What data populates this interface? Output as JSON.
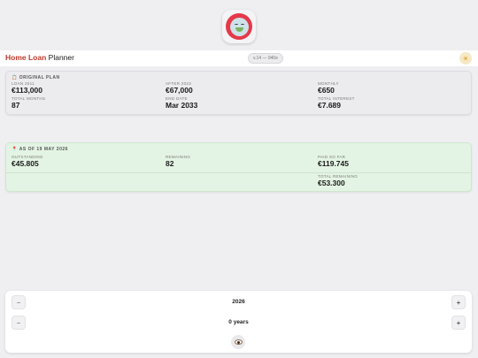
{
  "app": {
    "title_accent": "Home Loan",
    "title_rest": "Planner",
    "version": "v.14 — 940e",
    "icons": {
      "app": "sick-face-app-icon",
      "theme": "sun-icon"
    }
  },
  "plan": {
    "title": "ORIGINAL PLAN",
    "icon": "clipboard-icon",
    "fields": [
      {
        "label": "LOAN 2011",
        "value": "€113,000"
      },
      {
        "label": "AFTER 2023",
        "value": "€67,000"
      },
      {
        "label": "MONTHLY",
        "value": "€650"
      },
      {
        "label": "TOTAL MONTHS",
        "value": "87"
      },
      {
        "label": "END DATE",
        "value": "Mar 2033"
      },
      {
        "label": "TOTAL INTEREST",
        "value": "€7.689"
      }
    ]
  },
  "status": {
    "title": "AS OF 19 MAY 2026",
    "icon": "pin-icon",
    "fields": [
      {
        "label": "OUTSTANDING",
        "value": "€45.805"
      },
      {
        "label": "REMAINING",
        "value": "82"
      },
      {
        "label": "PAID SO FAR",
        "value": "€119.745"
      },
      {
        "label": "TOTAL REMAINING",
        "value": "€53.300"
      }
    ]
  },
  "controls": {
    "year_value": "2026",
    "years_value": "0 years",
    "minus_glyph": "−",
    "plus_glyph": "+",
    "toggle_icon": "eye-icon"
  }
}
